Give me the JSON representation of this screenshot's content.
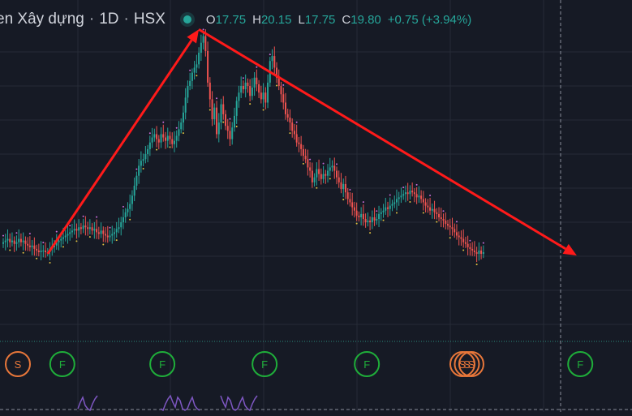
{
  "legend": {
    "symbol": "en Xây dựng",
    "interval": "1D",
    "exchange": "HSX",
    "open_label": "O",
    "open": "17.75",
    "high_label": "H",
    "high": "20.15",
    "low_label": "L",
    "low": "17.75",
    "close_label": "C",
    "close": "19.80",
    "change": "+0.75 (+3.94%)"
  },
  "colors": {
    "background": "#161a25",
    "up": "#26a69a",
    "down": "#ef5350",
    "arrow": "#ff1a1a",
    "marker_f": "#1fae3a",
    "marker_s": "#e8773a",
    "oscillator": "#7e57c2",
    "grid": "#262b37"
  },
  "markers": [
    {
      "label": "S",
      "kind": "s",
      "index": 0
    },
    {
      "label": "F",
      "kind": "f",
      "index": 20
    },
    {
      "label": "F",
      "kind": "f",
      "index": 65
    },
    {
      "label": "F",
      "kind": "f",
      "index": 111
    },
    {
      "label": "F",
      "kind": "f",
      "index": 157
    },
    {
      "label": "S",
      "kind": "s",
      "index": 200
    },
    {
      "label": "S",
      "kind": "s",
      "index": 202
    },
    {
      "label": "S",
      "kind": "s",
      "index": 204
    },
    {
      "label": "F",
      "kind": "f",
      "index": 253
    }
  ],
  "chart_data": {
    "type": "candlestick",
    "title": "",
    "ylabel": "",
    "ylim": [
      0,
      21
    ],
    "grid": true,
    "close": [
      7.6,
      7.7,
      7.8,
      7.6,
      7.7,
      7.5,
      7.6,
      7.8,
      7.6,
      7.7,
      7.5,
      7.4,
      7.3,
      7.4,
      7.2,
      7.1,
      7.0,
      7.1,
      7.1,
      7.0,
      7.0,
      7.2,
      7.3,
      7.4,
      7.6,
      7.7,
      7.8,
      7.9,
      8.0,
      8.1,
      8.2,
      8.3,
      8.4,
      8.3,
      8.5,
      8.4,
      8.6,
      8.5,
      8.4,
      8.5,
      8.3,
      8.4,
      8.2,
      8.1,
      8.3,
      8.1,
      8.0,
      7.9,
      8.0,
      8.1,
      8.2,
      8.4,
      8.5,
      8.8,
      9.1,
      9.4,
      9.6,
      9.9,
      10.4,
      11.0,
      11.6,
      12.2,
      12.5,
      12.6,
      12.9,
      13.2,
      13.6,
      13.9,
      14.1,
      13.8,
      13.6,
      14.1,
      13.9,
      13.7,
      14.0,
      13.8,
      13.5,
      13.7,
      14.0,
      14.4,
      14.8,
      15.4,
      16.3,
      17.0,
      17.3,
      17.8,
      18.1,
      18.3,
      19.0,
      19.6,
      20.0,
      19.1,
      17.2,
      16.2,
      15.0,
      15.7,
      14.1,
      14.8,
      15.9,
      15.3,
      14.6,
      14.3,
      13.8,
      14.5,
      15.2,
      16.1,
      16.6,
      17.0,
      16.8,
      17.2,
      17.0,
      16.4,
      16.9,
      17.5,
      17.1,
      16.6,
      16.2,
      16.6,
      16.0,
      17.2,
      18.5,
      18.8,
      18.1,
      17.5,
      17.0,
      16.5,
      16.0,
      15.3,
      15.1,
      14.8,
      14.3,
      14.1,
      13.6,
      13.5,
      13.2,
      12.8,
      12.6,
      12.1,
      11.9,
      11.2,
      11.5,
      12.0,
      11.7,
      11.4,
      11.7,
      11.6,
      11.9,
      12.1,
      12.2,
      11.9,
      11.5,
      11.2,
      10.8,
      11.1,
      10.6,
      10.2,
      10.0,
      9.7,
      9.5,
      9.2,
      9.1,
      9.3,
      9.0,
      8.8,
      8.9,
      8.8,
      9.1,
      8.9,
      9.0,
      9.3,
      9.4,
      9.5,
      9.7,
      9.6,
      9.8,
      9.9,
      10.0,
      10.2,
      10.3,
      10.4,
      10.5,
      10.6,
      10.5,
      10.7,
      10.6,
      10.5,
      10.3,
      10.4,
      10.2,
      10.0,
      9.8,
      9.7,
      9.5,
      9.6,
      9.4,
      9.3,
      9.1,
      9.0,
      8.9,
      8.7,
      8.6,
      8.5,
      8.4,
      8.2,
      8.0,
      7.9,
      7.8,
      7.6,
      7.5,
      7.3,
      7.2,
      7.1,
      7.0,
      6.9,
      7.1,
      6.9,
      7.0
    ],
    "events": [
      {
        "label": "S",
        "bar": 0
      },
      {
        "label": "F",
        "bar": 20
      },
      {
        "label": "F",
        "bar": 65
      },
      {
        "label": "F",
        "bar": 111
      },
      {
        "label": "F",
        "bar": 157
      },
      {
        "label": "S",
        "bar": 200
      },
      {
        "label": "S",
        "bar": 202
      },
      {
        "label": "S",
        "bar": 204
      },
      {
        "label": "F",
        "bar": 253
      }
    ],
    "trendlines": [
      {
        "from_bar": 20,
        "from_price": 6.9,
        "to_bar": 88,
        "to_price": 20.4
      },
      {
        "from_bar": 88,
        "from_price": 20.4,
        "to_bar": 258,
        "to_price": 6.8
      }
    ],
    "oscillator_panel": {
      "color": "#7e57c2",
      "values": [
        0.2,
        0.6,
        0.9,
        0.4,
        0.2,
        0.1,
        0.5,
        0.8,
        1.0,
        0.6,
        0.3,
        0.9,
        0.7,
        0.2,
        0.1
      ]
    }
  }
}
